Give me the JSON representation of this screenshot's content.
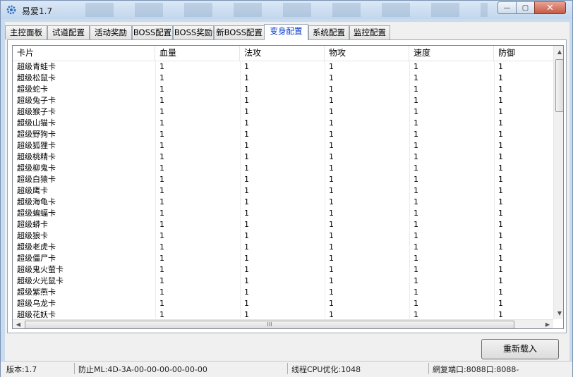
{
  "window": {
    "title": "易爱1.7",
    "min_label": "—",
    "max_label": "▢",
    "close_label": "✕"
  },
  "tabs": [
    {
      "label": "主控面板",
      "active": false
    },
    {
      "label": "试道配置",
      "active": false
    },
    {
      "label": "活动奖励",
      "active": false
    },
    {
      "label": "BOSS配置",
      "active": false
    },
    {
      "label": "BOSS奖励",
      "active": false
    },
    {
      "label": "新BOSS配置",
      "active": false
    },
    {
      "label": "变身配置",
      "active": true
    },
    {
      "label": "系统配置",
      "active": false
    },
    {
      "label": "监控配置",
      "active": false
    }
  ],
  "table": {
    "columns": [
      "卡片",
      "血量",
      "法攻",
      "物攻",
      "速度",
      "防御"
    ],
    "rows": [
      [
        "超级青蛙卡",
        "1",
        "1",
        "1",
        "1",
        "1"
      ],
      [
        "超级松鼠卡",
        "1",
        "1",
        "1",
        "1",
        "1"
      ],
      [
        "超级蛇卡",
        "1",
        "1",
        "1",
        "1",
        "1"
      ],
      [
        "超级兔子卡",
        "1",
        "1",
        "1",
        "1",
        "1"
      ],
      [
        "超级猴子卡",
        "1",
        "1",
        "1",
        "1",
        "1"
      ],
      [
        "超级山猫卡",
        "1",
        "1",
        "1",
        "1",
        "1"
      ],
      [
        "超级野狗卡",
        "1",
        "1",
        "1",
        "1",
        "1"
      ],
      [
        "超级狐狸卡",
        "1",
        "1",
        "1",
        "1",
        "1"
      ],
      [
        "超级桃精卡",
        "1",
        "1",
        "1",
        "1",
        "1"
      ],
      [
        "超级柳鬼卡",
        "1",
        "1",
        "1",
        "1",
        "1"
      ],
      [
        "超级白猿卡",
        "1",
        "1",
        "1",
        "1",
        "1"
      ],
      [
        "超级鹰卡",
        "1",
        "1",
        "1",
        "1",
        "1"
      ],
      [
        "超级海龟卡",
        "1",
        "1",
        "1",
        "1",
        "1"
      ],
      [
        "超级蝙蝠卡",
        "1",
        "1",
        "1",
        "1",
        "1"
      ],
      [
        "超级蟒卡",
        "1",
        "1",
        "1",
        "1",
        "1"
      ],
      [
        "超级狼卡",
        "1",
        "1",
        "1",
        "1",
        "1"
      ],
      [
        "超级老虎卡",
        "1",
        "1",
        "1",
        "1",
        "1"
      ],
      [
        "超级僵尸卡",
        "1",
        "1",
        "1",
        "1",
        "1"
      ],
      [
        "超级鬼火萤卡",
        "1",
        "1",
        "1",
        "1",
        "1"
      ],
      [
        "超级火光鼠卡",
        "1",
        "1",
        "1",
        "1",
        "1"
      ],
      [
        "超级紫燕卡",
        "1",
        "1",
        "1",
        "1",
        "1"
      ],
      [
        "超级乌龙卡",
        "1",
        "1",
        "1",
        "1",
        "1"
      ],
      [
        "超级花妖卡",
        "1",
        "1",
        "1",
        "1",
        "1"
      ]
    ]
  },
  "scroll": {
    "up_arrow": "▲",
    "down_arrow": "▼",
    "left_arrow": "◀",
    "right_arrow": "▶",
    "h_grip": "III",
    "v_grip": "≡"
  },
  "reload_button": "重新载入",
  "statusbar": {
    "version": "版本:1.7",
    "guard": "防止ML:4D-3A-00-00-00-00-00-00",
    "thread": "线程CPU优化:1048",
    "port": "網复端口:8088口:8088-"
  }
}
